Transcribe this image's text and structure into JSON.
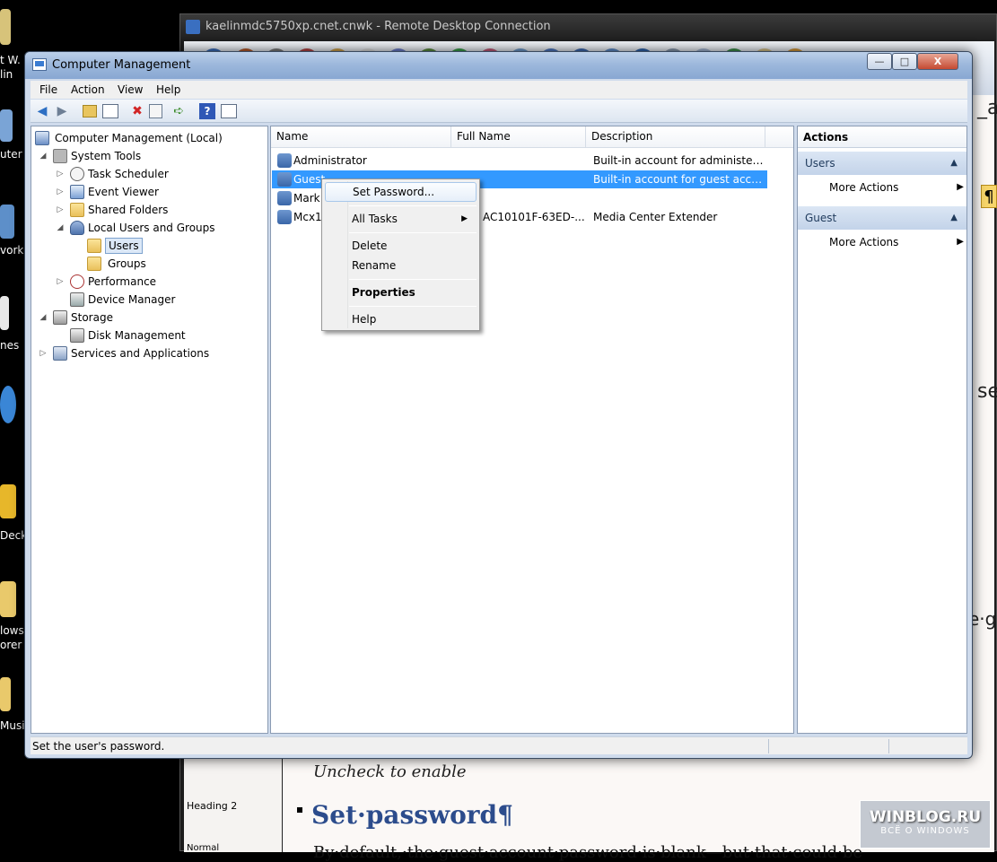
{
  "desktop": {
    "labels": [
      "t W.",
      "lin",
      "uter",
      "vork",
      "nes",
      "Deck",
      "lows",
      "orer",
      "Music"
    ]
  },
  "remote_desktop": {
    "title": "kaelinmdc5750xp.cnet.cnwk - Remote Desktop Connection",
    "doc_fragments": {
      "frag_right_1": "_a",
      "frag_right_2": "se",
      "frag_right_3": "e·g",
      "pilcrow": "¶",
      "bottom_text": "Uncheck to enable",
      "style_heading2": "Heading 2",
      "style_normal": "Normal",
      "heading": "Set·password¶",
      "body_line": "By·default,·the·guest·account·password·is·blank—but·that·could·be"
    },
    "watermark": {
      "line1": "WINBLOG.RU",
      "line2": "ВСЁ О WINDOWS"
    }
  },
  "window": {
    "title": "Computer Management",
    "buttons": {
      "minimize": "—",
      "maximize": "□",
      "close": "X"
    }
  },
  "menu": [
    "File",
    "Action",
    "View",
    "Help"
  ],
  "tree": [
    {
      "label": "Computer Management (Local)"
    },
    {
      "label": "System Tools"
    },
    {
      "label": "Task Scheduler"
    },
    {
      "label": "Event Viewer"
    },
    {
      "label": "Shared Folders"
    },
    {
      "label": "Local Users and Groups"
    },
    {
      "label": "Users"
    },
    {
      "label": "Groups"
    },
    {
      "label": "Performance"
    },
    {
      "label": "Device Manager"
    },
    {
      "label": "Storage"
    },
    {
      "label": "Disk Management"
    },
    {
      "label": "Services and Applications"
    }
  ],
  "list": {
    "columns": [
      "Name",
      "Full Name",
      "Description"
    ],
    "rows": [
      {
        "name": "Administrator",
        "full_name": "",
        "description": "Built-in account for administeri..."
      },
      {
        "name": "Guest",
        "full_name": "",
        "description": "Built-in account for guest acce..."
      },
      {
        "name": "Mark",
        "full_name": "",
        "description": ""
      },
      {
        "name": "Mcx1",
        "full_name": "AC10101F-63ED-...",
        "description": "Media Center Extender"
      }
    ]
  },
  "context_menu": {
    "set_password": "Set Password...",
    "all_tasks": "All Tasks",
    "delete": "Delete",
    "rename": "Rename",
    "properties": "Properties",
    "help": "Help"
  },
  "actions": {
    "header": "Actions",
    "groups": [
      {
        "title": "Users",
        "item": "More Actions"
      },
      {
        "title": "Guest",
        "item": "More Actions"
      }
    ]
  },
  "status": "Set the user's password."
}
